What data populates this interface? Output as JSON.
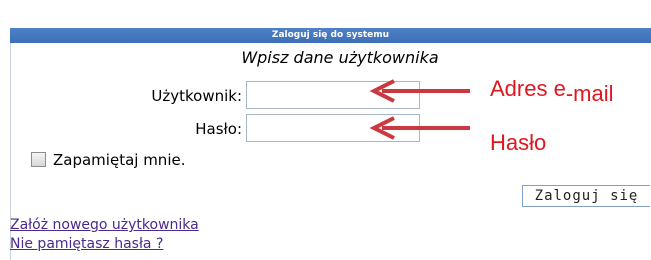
{
  "header": {
    "title": "Zaloguj się do systemu"
  },
  "form": {
    "subtitle": "Wpisz dane użytkownika",
    "username_label": "Użytkownik:",
    "username_value": "",
    "password_label": "Hasło:",
    "password_value": "",
    "remember_label": "Zapamiętaj mnie.",
    "remember_checked": false,
    "login_button": "Zaloguj się"
  },
  "links": {
    "register": "Załóż nowego użytkownika",
    "forgot": "Nie pamiętasz hasła ?"
  },
  "annotations": {
    "email_part1": "Adres e",
    "email_part2": "-mail",
    "password": "Hasło",
    "color": "#e0161f"
  },
  "icons": {
    "arrow": "left-arrow-icon"
  }
}
